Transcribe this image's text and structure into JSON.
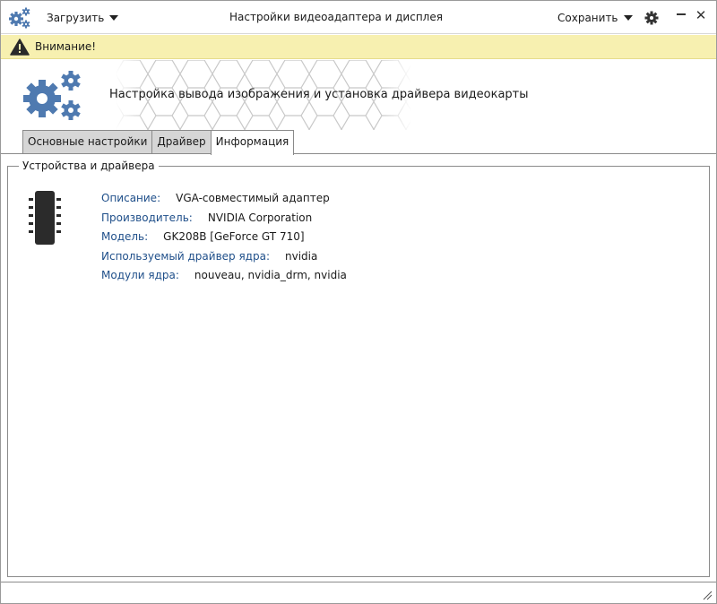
{
  "titlebar": {
    "app_icon": "gears-icon",
    "load_label": "Загрузить",
    "title": "Настройки видеоадаптера и дисплея",
    "save_label": "Сохранить",
    "settings_icon": "gear-icon",
    "minimize_icon": "minimize-icon",
    "close_icon": "close-icon",
    "close_glyph": "✕"
  },
  "warning": {
    "icon": "warning-icon",
    "text": "Внимание!",
    "background": "#f7f0b0"
  },
  "header": {
    "icon": "gears-icon",
    "title": "Настройка вывода изображения и установка драйвера видеокарты"
  },
  "tabs": [
    {
      "label": "Основные настройки",
      "active": false
    },
    {
      "label": "Драйвер",
      "active": false
    },
    {
      "label": "Информация",
      "active": true
    }
  ],
  "group": {
    "title": "Устройства и драйвера",
    "icon": "chip-icon",
    "rows": [
      {
        "label": "Описание:",
        "value": "VGA-совместимый адаптер"
      },
      {
        "label": "Производитель:",
        "value": "NVIDIA Corporation"
      },
      {
        "label": "Модель:",
        "value": "GK208B [GeForce GT 710]"
      },
      {
        "label": "Используемый драйвер ядра:",
        "value": "nvidia"
      },
      {
        "label": "Модули ядра:",
        "value": "nouveau, nvidia_drm, nvidia"
      }
    ]
  },
  "colors": {
    "accent_blue": "#4f7ab0",
    "label_blue": "#1f4f8a",
    "tab_inactive": "#d6d6d6"
  }
}
